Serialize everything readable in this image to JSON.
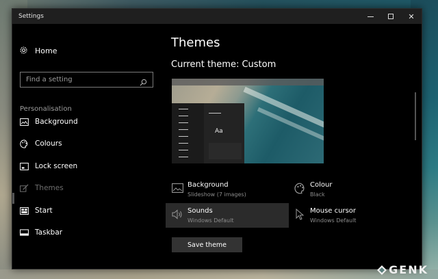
{
  "window": {
    "title": "Settings"
  },
  "sidebar": {
    "home_label": "Home",
    "search_placeholder": "Find a setting",
    "section_label": "Personalisation",
    "items": [
      {
        "label": "Background",
        "icon": "image-icon",
        "active": false
      },
      {
        "label": "Colours",
        "icon": "palette-icon",
        "active": false
      },
      {
        "label": "Lock screen",
        "icon": "lock-screen-icon",
        "active": false
      },
      {
        "label": "Themes",
        "icon": "brush-icon",
        "active": true
      },
      {
        "label": "Start",
        "icon": "start-icon",
        "active": false
      },
      {
        "label": "Taskbar",
        "icon": "taskbar-icon",
        "active": false
      }
    ]
  },
  "main": {
    "page_title": "Themes",
    "current_theme": "Current theme: Custom",
    "preview_sample": "Aa",
    "settings": [
      {
        "title": "Background",
        "value": "Slideshow (7 images)",
        "icon": "image-icon"
      },
      {
        "title": "Colour",
        "value": "Black",
        "icon": "palette-icon"
      },
      {
        "title": "Sounds",
        "value": "Windows Default",
        "icon": "speaker-icon"
      },
      {
        "title": "Mouse cursor",
        "value": "Windows Default",
        "icon": "cursor-icon"
      }
    ],
    "save_button": "Save theme"
  },
  "watermark": {
    "text": "GENK"
  },
  "colors": {
    "window_bg": "#000000",
    "titlebar_bg": "#1f1f1f",
    "button_bg": "#333333",
    "muted_text": "#8c8c8c"
  }
}
